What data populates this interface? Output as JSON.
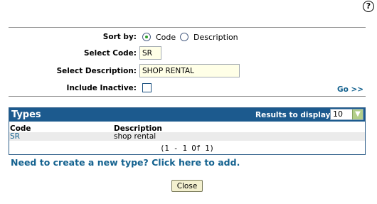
{
  "help": {
    "icon": "help-icon",
    "symbol": "?"
  },
  "form": {
    "sort_by_label": "Sort by:",
    "sort_options": [
      "Code",
      "Description"
    ],
    "sort_selected": "Code",
    "select_code_label": "Select Code:",
    "select_code_value": "SR",
    "select_description_label": "Select Description:",
    "select_description_value": "SHOP RENTAL",
    "include_inactive_label": "Include Inactive:",
    "include_inactive_checked": false,
    "go_label": "Go >>"
  },
  "types_panel": {
    "title": "Types",
    "results_label": "Results to display:",
    "results_value": "10",
    "columns": [
      "Code",
      "Description"
    ],
    "rows": [
      {
        "code": "SR",
        "description": "shop rental"
      }
    ],
    "pager": "(1 - 1 Of 1)"
  },
  "add_link": "Need to create a new type? Click here to add.",
  "close_label": "Close",
  "colors": {
    "link": "#14628f",
    "header_bg": "#1c5a8e",
    "input_bg": "#ffffe7",
    "button_bg": "#f3f0cf"
  }
}
